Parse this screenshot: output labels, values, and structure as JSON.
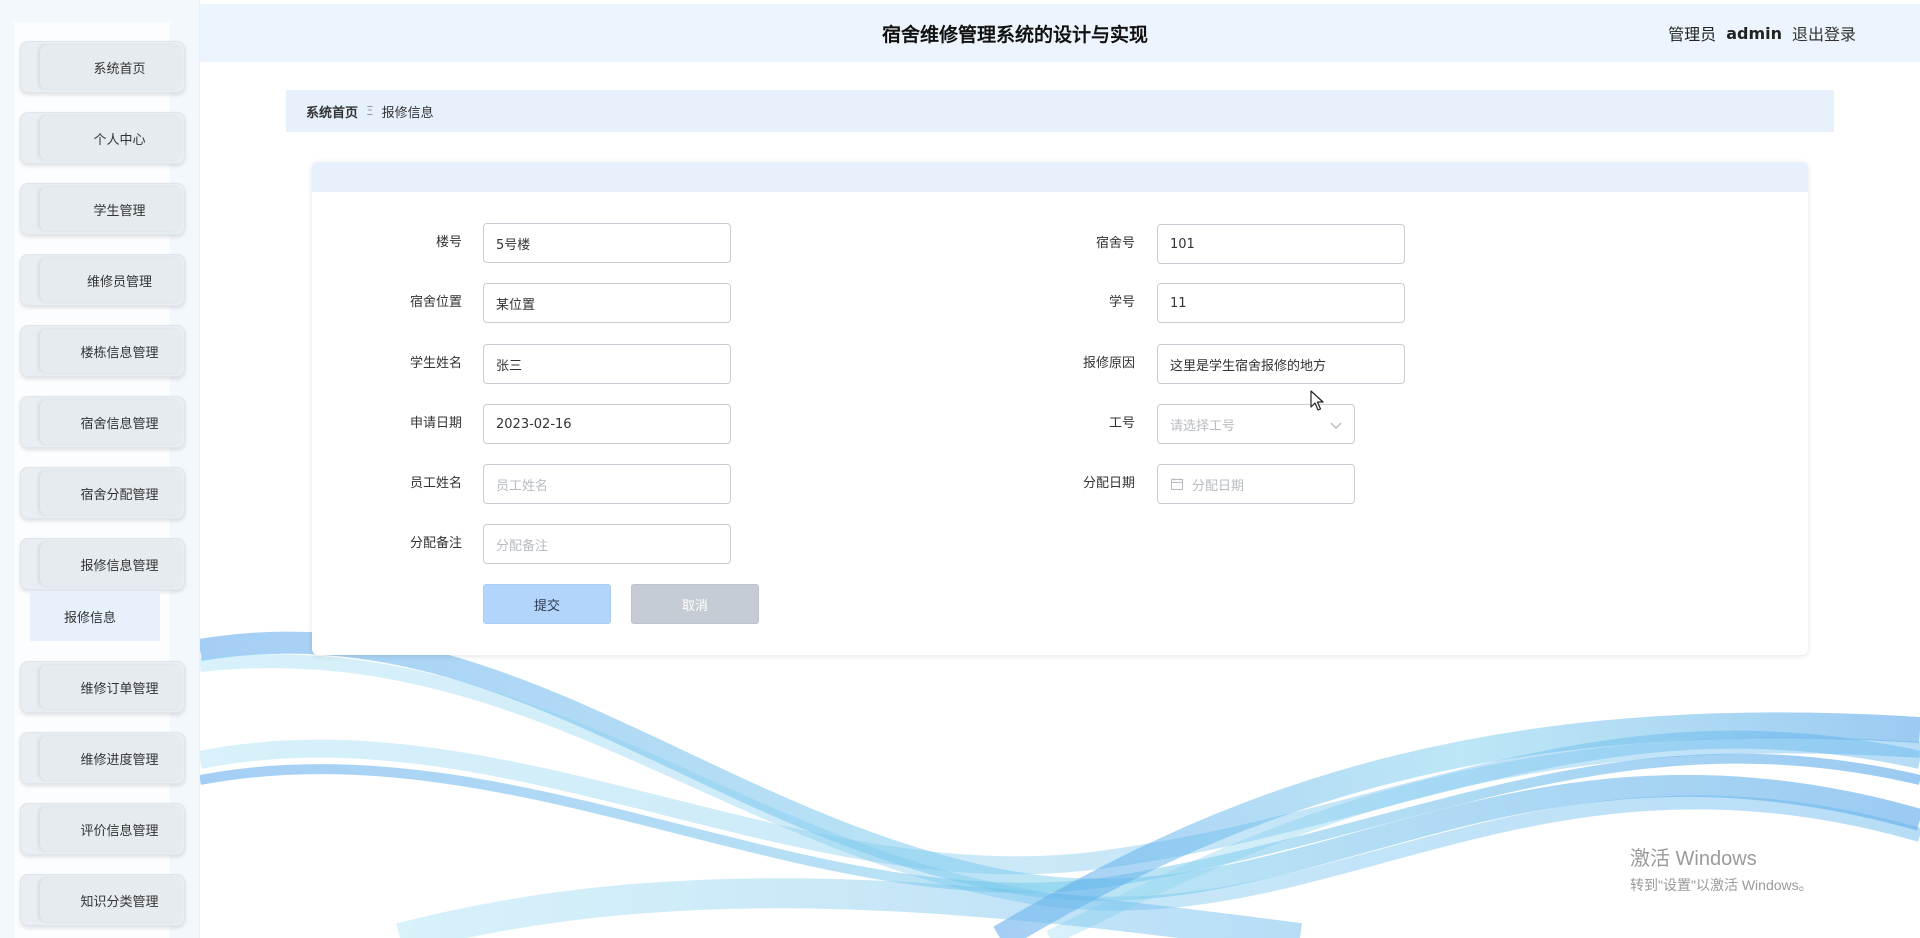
{
  "header": {
    "title": "宿舍维修管理系统的设计与实现",
    "role": "管理员",
    "username": "admin",
    "logout": "退出登录"
  },
  "sidebar": {
    "items": [
      {
        "label": "系统首页"
      },
      {
        "label": "个人中心"
      },
      {
        "label": "学生管理"
      },
      {
        "label": "维修员管理"
      },
      {
        "label": "楼栋信息管理"
      },
      {
        "label": "宿舍信息管理"
      },
      {
        "label": "宿舍分配管理"
      },
      {
        "label": "报修信息管理"
      },
      {
        "label": "维修订单管理"
      },
      {
        "label": "维修进度管理"
      },
      {
        "label": "评价信息管理"
      },
      {
        "label": "知识分类管理"
      }
    ],
    "submenu": {
      "label": "报修信息"
    }
  },
  "breadcrumb": {
    "home": "系统首页",
    "separator": "Ξ",
    "current": "报修信息"
  },
  "form": {
    "building": {
      "label": "楼号",
      "value": "5号楼"
    },
    "dorm_no": {
      "label": "宿舍号",
      "value": "101"
    },
    "dorm_location": {
      "label": "宿舍位置",
      "value": "某位置"
    },
    "student_no": {
      "label": "学号",
      "value": "11"
    },
    "student_name": {
      "label": "学生姓名",
      "value": "张三"
    },
    "repair_reason": {
      "label": "报修原因",
      "value": "这里是学生宿舍报修的地方"
    },
    "apply_date": {
      "label": "申请日期",
      "value": "2023-02-16"
    },
    "staff_no": {
      "label": "工号",
      "placeholder": "请选择工号"
    },
    "staff_name": {
      "label": "员工姓名",
      "placeholder": "员工姓名"
    },
    "assign_date": {
      "label": "分配日期",
      "placeholder": "分配日期"
    },
    "assign_note": {
      "label": "分配备注",
      "placeholder": "分配备注"
    },
    "submit": "提交",
    "cancel": "取消"
  },
  "watermark": {
    "line1": "激活 Windows",
    "line2": "转到\"设置\"以激活 Windows。"
  },
  "colors": {
    "header_bg": "#ecf5fd",
    "breadcrumb_bg": "#e6f1fc",
    "submit_bg": "#b3d4fb",
    "cancel_bg": "#c6ccd4"
  }
}
